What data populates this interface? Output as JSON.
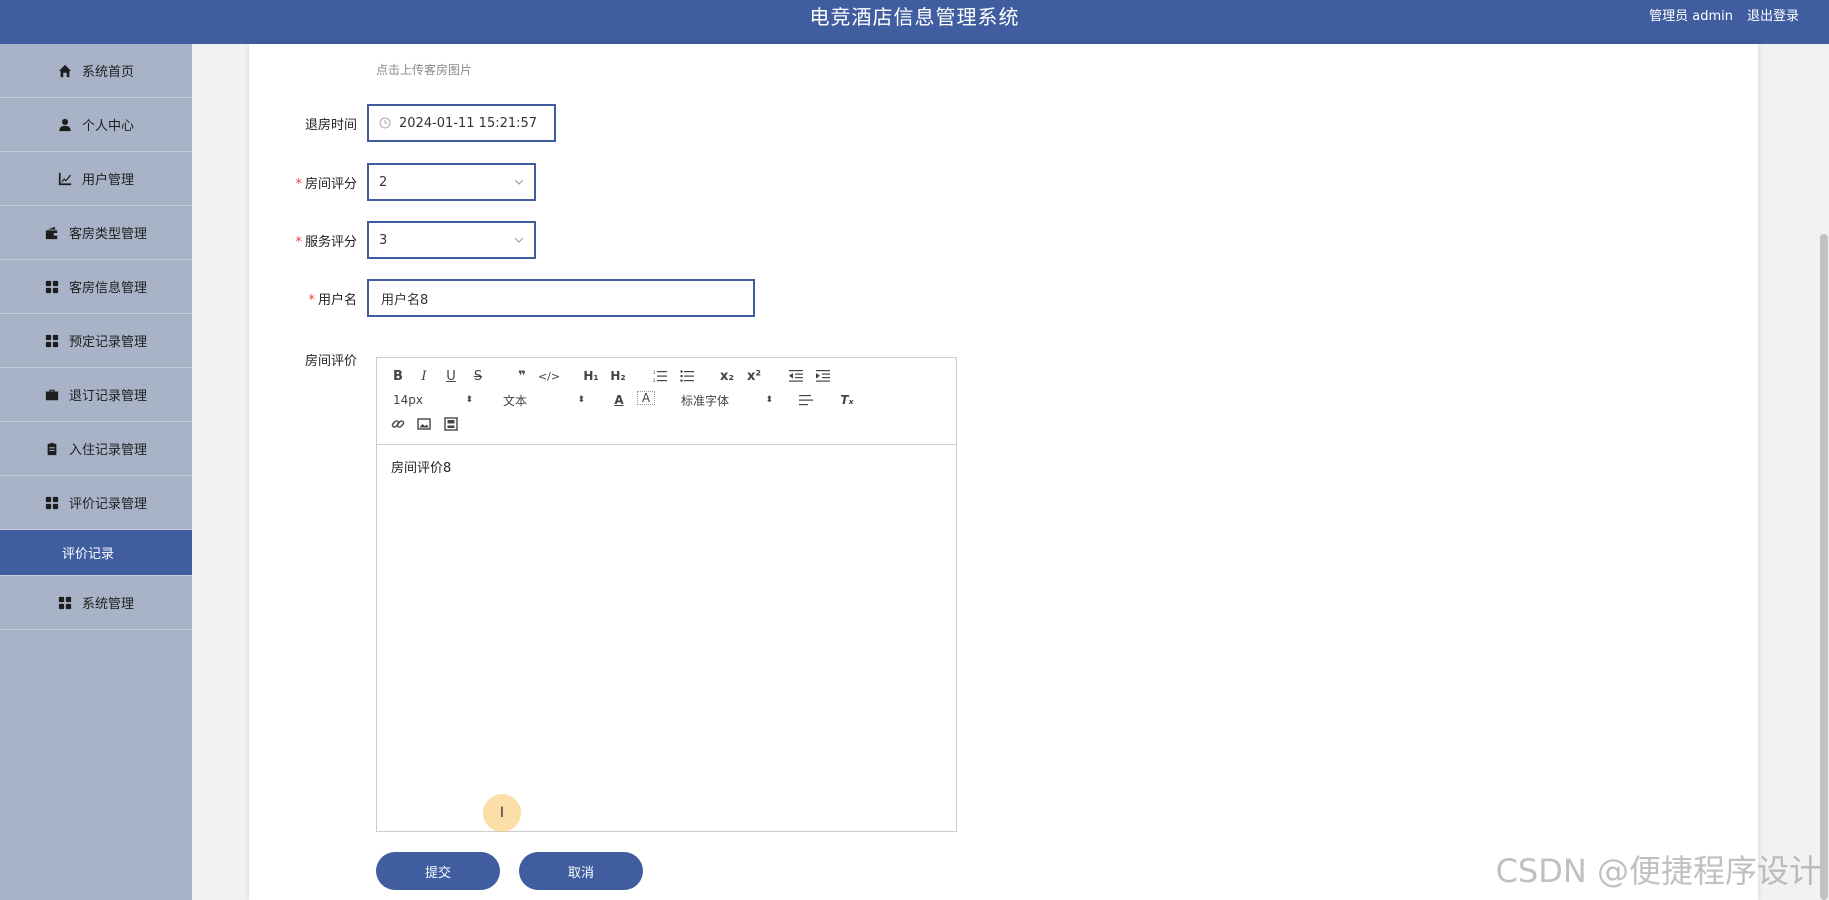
{
  "header": {
    "title": "电竞酒店信息管理系统",
    "user_label": "管理员 admin",
    "logout_label": "退出登录"
  },
  "sidebar": {
    "items": [
      {
        "label": "系统首页",
        "icon": "home-icon"
      },
      {
        "label": "个人中心",
        "icon": "user-icon"
      },
      {
        "label": "用户管理",
        "icon": "chart-icon"
      },
      {
        "label": "客房类型管理",
        "icon": "wallet-icon"
      },
      {
        "label": "客房信息管理",
        "icon": "grid-icon"
      },
      {
        "label": "预定记录管理",
        "icon": "grid-icon"
      },
      {
        "label": "退订记录管理",
        "icon": "briefcase-icon"
      },
      {
        "label": "入住记录管理",
        "icon": "clipboard-icon"
      },
      {
        "label": "评价记录管理",
        "icon": "grid-icon"
      },
      {
        "label": "系统管理",
        "icon": "grid-icon"
      }
    ],
    "sub_item": "评价记录"
  },
  "form": {
    "upload_hint": "点击上传客房图片",
    "checkout_time": {
      "label": "退房时间",
      "value": "2024-01-11 15:21:57"
    },
    "room_rating": {
      "label": "房间评分",
      "value": "2"
    },
    "service_rating": {
      "label": "服务评分",
      "value": "3"
    },
    "username": {
      "label": "用户名",
      "value": "用户名8"
    },
    "room_review": {
      "label": "房间评价",
      "value": "房间评价8"
    }
  },
  "editor": {
    "font_size": "14px",
    "text_style": "文本",
    "font_family": "标准字体"
  },
  "buttons": {
    "submit": "提交",
    "cancel": "取消"
  },
  "watermark": "CSDN @便捷程序设计",
  "colors": {
    "primary": "#3f5d9f",
    "sidebar": "#a9b3c8",
    "required": "#e04646"
  }
}
